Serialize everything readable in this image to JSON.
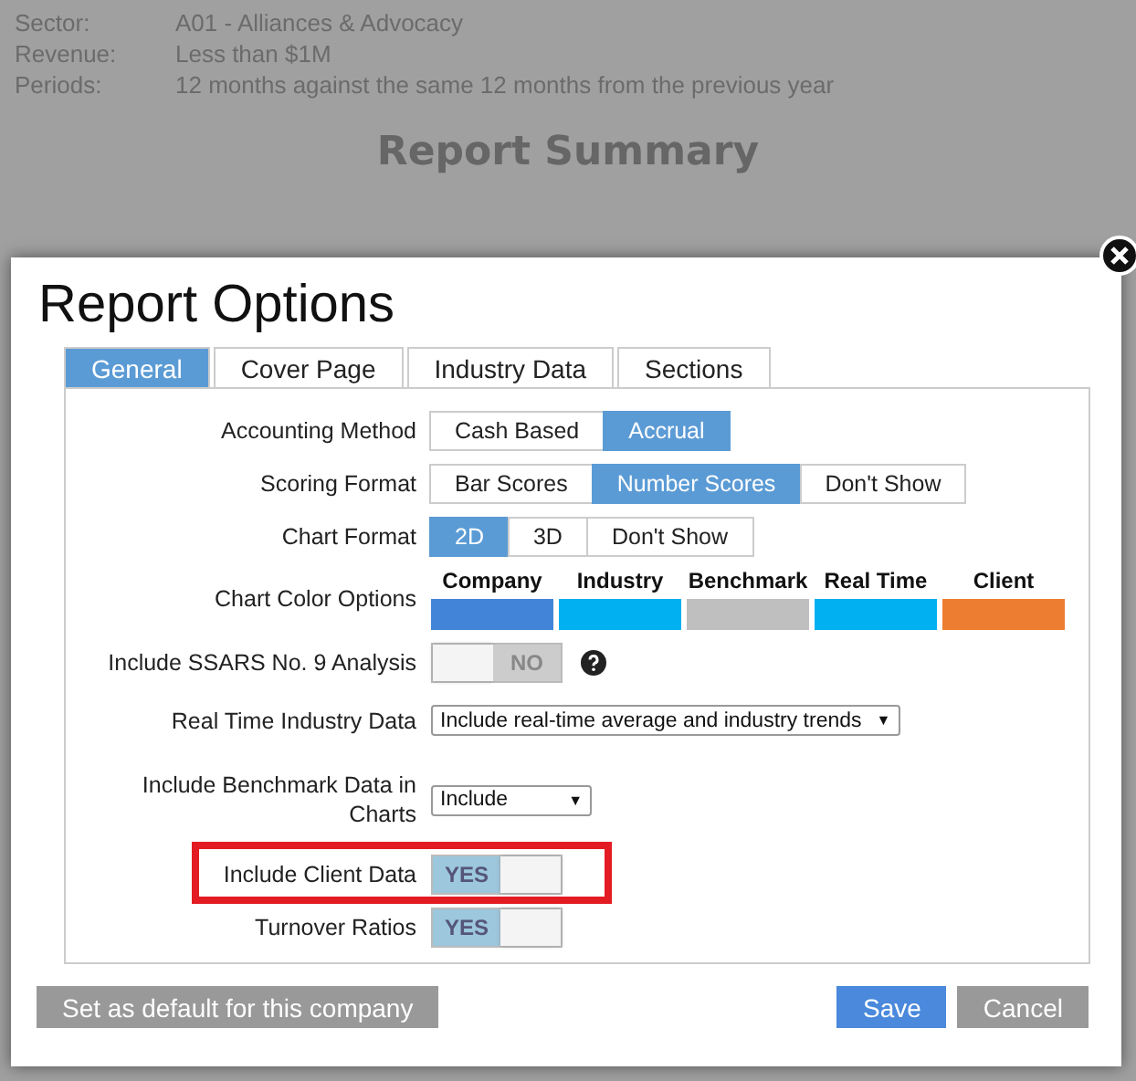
{
  "background": {
    "details": [
      {
        "label": "Sector:",
        "value": "A01 - Alliances & Advocacy"
      },
      {
        "label": "Revenue:",
        "value": "Less than $1M"
      },
      {
        "label": "Periods:",
        "value": "12 months against the same 12 months from the previous year"
      }
    ],
    "heading": "Report Summary"
  },
  "dialog": {
    "title": "Report Options",
    "tabs": [
      {
        "label": "General",
        "selected": true
      },
      {
        "label": "Cover Page",
        "selected": false
      },
      {
        "label": "Industry Data",
        "selected": false
      },
      {
        "label": "Sections",
        "selected": false
      }
    ],
    "settings": [
      {
        "kind": "segmented",
        "label": "Accounting Method",
        "options": [
          {
            "label": "Cash Based",
            "selected": false
          },
          {
            "label": "Accrual",
            "selected": true
          }
        ]
      },
      {
        "kind": "segmented",
        "label": "Scoring Format",
        "options": [
          {
            "label": "Bar Scores",
            "selected": false
          },
          {
            "label": "Number Scores",
            "selected": true
          },
          {
            "label": "Don't Show",
            "selected": false
          }
        ]
      },
      {
        "kind": "segmented",
        "label": "Chart Format",
        "options": [
          {
            "label": "2D",
            "selected": true
          },
          {
            "label": "3D",
            "selected": false
          },
          {
            "label": "Don't Show",
            "selected": false
          }
        ]
      },
      {
        "kind": "colors",
        "label": "Chart Color Options",
        "swatches": [
          {
            "name": "Company",
            "color": "#4285d8"
          },
          {
            "name": "Industry",
            "color": "#00b0f0"
          },
          {
            "name": "Benchmark",
            "color": "#bfbfbf"
          },
          {
            "name": "Real Time",
            "color": "#00b0f0"
          },
          {
            "name": "Client",
            "color": "#ed7d31"
          }
        ]
      },
      {
        "kind": "toggle",
        "label": "Include SSARS No. 9 Analysis",
        "on": false,
        "state_text": "NO",
        "help": true
      },
      {
        "kind": "select",
        "label": "Real Time Industry Data",
        "value": "Include real-time average and industry trends",
        "arrow": "▼"
      },
      {
        "kind": "select",
        "label": "Include Benchmark Data in Charts",
        "value": "Include",
        "arrow": "▼"
      },
      {
        "kind": "toggle",
        "label": "Include Client Data",
        "on": true,
        "state_text": "YES",
        "highlighted": true
      },
      {
        "kind": "toggle",
        "label": "Turnover Ratios",
        "on": true,
        "state_text": "YES"
      }
    ],
    "default_button": "Set as default for this company",
    "save_button": "Save",
    "cancel_button": "Cancel"
  }
}
